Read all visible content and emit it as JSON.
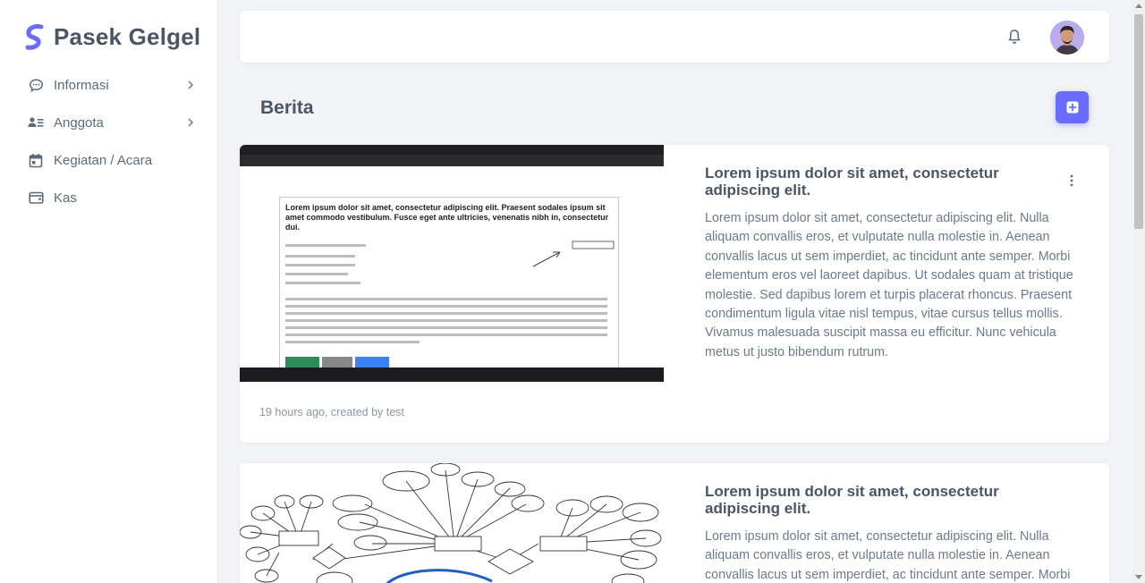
{
  "brand": {
    "name": "Pasek Gelgel"
  },
  "sidebar": {
    "items": [
      {
        "label": "Informasi",
        "icon": "chat-icon",
        "has_submenu": true
      },
      {
        "label": "Anggota",
        "icon": "users-icon",
        "has_submenu": true
      },
      {
        "label": "Kegiatan / Acara",
        "icon": "calendar-icon",
        "has_submenu": false
      },
      {
        "label": "Kas",
        "icon": "wallet-icon",
        "has_submenu": false
      }
    ]
  },
  "topbar": {
    "notification_icon": "bell-icon",
    "avatar": "user-avatar"
  },
  "page": {
    "title": "Berita",
    "add_icon": "plus-square-icon",
    "accent": "#696cff"
  },
  "posts": [
    {
      "title": "Lorem ipsum dolor sit amet, consectetur adipiscing elit.",
      "body": "Lorem ipsum dolor sit amet, consectetur adipiscing elit. Nulla aliquam convallis eros, et vulputate nulla molestie in. Aenean convallis lacus ut sem imperdiet, ac tincidunt ante semper. Morbi elementum eros vel laoreet dapibus. Ut sodales quam at tristique molestie. Sed dapibus lorem et turpis placerat rhoncus. Praesent condimentum ligula vitae nisl tempus, vitae cursus tellus mollis. Vivamus malesuada suscipit massa eu efficitur. Nunc vehicula metus ut justo bibendum rutrum.",
      "meta": "19 hours ago, created by test",
      "image_doc_title": "Lorem ipsum dolor sit amet, consectetur adipiscing elit. Praesent sodales ipsum sit amet commodo vestibulum. Fusce eget ante ultricies, venenatis nibh in, consectetur dui."
    },
    {
      "title": "Lorem ipsum dolor sit amet, consectetur adipiscing elit.",
      "body": "Lorem ipsum dolor sit amet, consectetur adipiscing elit. Nulla aliquam convallis eros, et vulputate nulla molestie in. Aenean convallis lacus ut sem imperdiet, ac tincidunt ante semper. Morbi"
    }
  ]
}
